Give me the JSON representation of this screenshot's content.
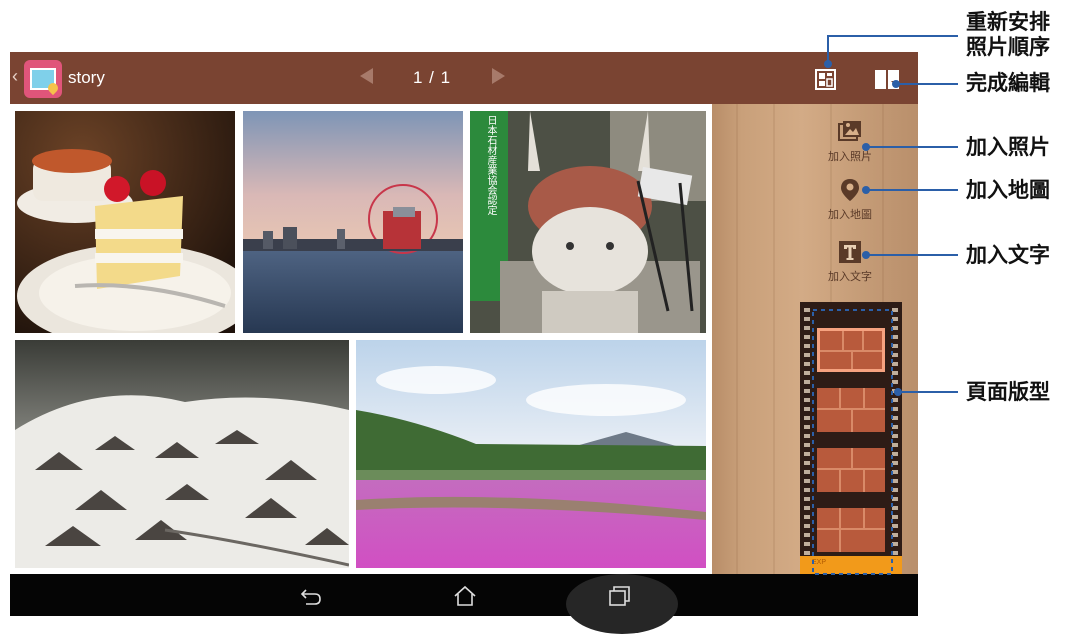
{
  "toolbar": {
    "title": "story",
    "page_indicator": "1 / 1"
  },
  "tools": [
    {
      "label": "加入照片",
      "icon": "add-photo-icon"
    },
    {
      "label": "加入地圖",
      "icon": "map-pin-icon"
    },
    {
      "label": "加入文字",
      "icon": "text-icon"
    }
  ],
  "photo_signs": {
    "stone_sign": "日本石材産業協会認定"
  },
  "film": {
    "footer_text": "EXP"
  },
  "callouts": {
    "rearrange_line1": "重新安排",
    "rearrange_line2": "照片順序",
    "done_edit": "完成編輯",
    "add_photo": "加入照片",
    "add_map": "加入地圖",
    "add_text": "加入文字",
    "page_layout": "頁面版型"
  },
  "colors": {
    "topbar": "#7a4432",
    "accent_pink": "#e0557a",
    "film_highlight": "#f6a280",
    "film_footer": "#f29a1a"
  }
}
